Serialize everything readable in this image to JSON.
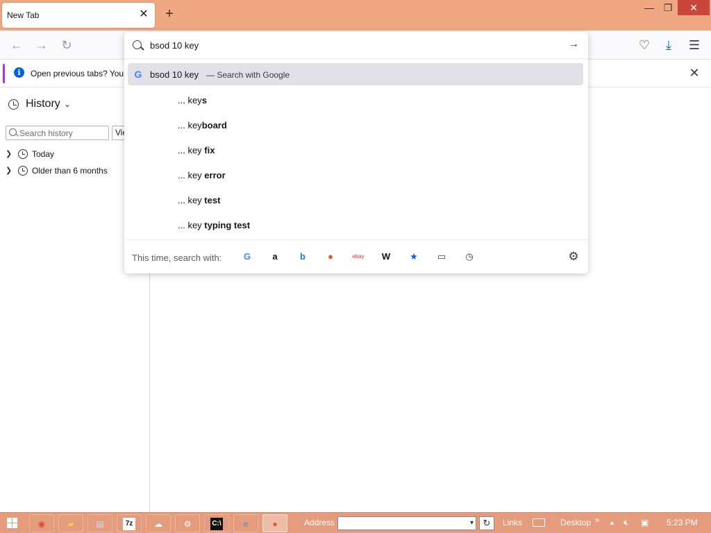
{
  "window": {
    "tab_title": "New Tab",
    "new_tab": "+",
    "minimize": "—",
    "restore": "❐",
    "close": "✕"
  },
  "navbar": {
    "back": "←",
    "forward": "→",
    "reload": "↻",
    "pocket": "♡",
    "downloads": "⤓",
    "menu": "☰"
  },
  "notification": {
    "text": "Open previous tabs? You",
    "close": "✕"
  },
  "sidebar": {
    "title": "History",
    "chevron": "⌄",
    "search_placeholder": "Search history",
    "view_label": "View",
    "items": [
      {
        "label": "Today"
      },
      {
        "label": "Older than 6 months"
      }
    ]
  },
  "urlbar": {
    "value": "bsod 10 key",
    "go": "→",
    "heuristic": {
      "query": "bsod 10 key",
      "action": "— Search with Google"
    },
    "suggestions": [
      {
        "prefix": "... key",
        "bold": "s"
      },
      {
        "prefix": "... key",
        "bold": "board"
      },
      {
        "prefix": "... key ",
        "bold": "fix"
      },
      {
        "prefix": "... key ",
        "bold": "error"
      },
      {
        "prefix": "... key ",
        "bold": "test"
      },
      {
        "prefix": "... key ",
        "bold": "typing test"
      }
    ],
    "oneoff_label": "This time, search with:",
    "engines": [
      {
        "name": "google-icon",
        "glyph": "G",
        "color": "#4285f4"
      },
      {
        "name": "amazon-icon",
        "glyph": "a",
        "color": "#111111"
      },
      {
        "name": "bing-icon",
        "glyph": "b",
        "color": "#1f7ae0"
      },
      {
        "name": "duckduckgo-icon",
        "glyph": "●",
        "color": "#de5833"
      },
      {
        "name": "ebay-icon",
        "glyph": "ebay",
        "color": "#e53238"
      },
      {
        "name": "wikipedia-icon",
        "glyph": "W",
        "color": "#111111"
      },
      {
        "name": "bookmarks-star-icon",
        "glyph": "★",
        "color": "#0060df"
      },
      {
        "name": "tabs-icon",
        "glyph": "▭",
        "color": "#3a3944"
      },
      {
        "name": "history-clock-icon",
        "glyph": "◷",
        "color": "#3a3944"
      }
    ],
    "settings": "⚙"
  },
  "taskbar": {
    "address_label": "Address",
    "links_label": "Links",
    "desktop_label": "Desktop",
    "overflow": "»",
    "tray_arrow": "▲",
    "time": "5:23 PM",
    "refresh": "↻",
    "addr_drop": "▾",
    "apps": [
      {
        "name": "chrome-taskbar-icon",
        "glyph": "◉",
        "color": "#e0463a"
      },
      {
        "name": "file-explorer-taskbar-icon",
        "glyph": "▰",
        "color": "#f2c94c"
      },
      {
        "name": "notepad-taskbar-icon",
        "glyph": "▤",
        "color": "#bfe3f2"
      },
      {
        "name": "7zip-taskbar-icon",
        "glyph": "7z",
        "color": "#111111"
      },
      {
        "name": "onedrive-taskbar-icon",
        "glyph": "☁",
        "color": "#ffffff"
      },
      {
        "name": "settings-taskbar-icon",
        "glyph": "⚙",
        "color": "#ffffff"
      },
      {
        "name": "cmd-taskbar-icon",
        "glyph": "C:\\",
        "color": "#ffffff"
      },
      {
        "name": "ie-taskbar-icon",
        "glyph": "e",
        "color": "#3b8fdd"
      },
      {
        "name": "firefox-taskbar-icon",
        "glyph": "●",
        "color": "#e6582c"
      }
    ]
  },
  "colors": {
    "titlebar": "#f0a882",
    "taskbar": "#e59c7c",
    "accent": "#0060df",
    "highlight_row": "#e0e0e6"
  }
}
